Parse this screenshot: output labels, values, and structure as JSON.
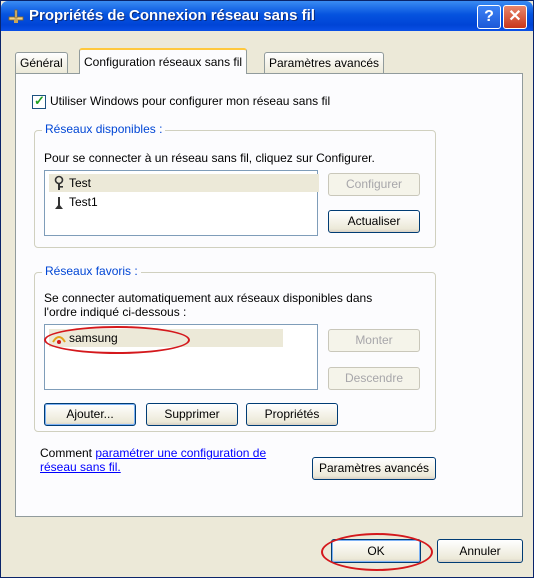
{
  "window": {
    "title": "Propriétés de Connexion réseau sans fil",
    "help_label": "?",
    "close_label": "✕"
  },
  "tabs": [
    {
      "label": "Général",
      "active": false
    },
    {
      "label": "Configuration réseaux sans fil",
      "active": true
    },
    {
      "label": "Paramètres avancés",
      "active": false
    }
  ],
  "use_windows_checkbox": {
    "label": "Utiliser Windows pour configurer mon réseau sans fil",
    "checked": true
  },
  "available_networks": {
    "title": "Réseaux disponibles :",
    "description": "Pour se connecter à un réseau sans fil, cliquez sur Configurer.",
    "items": [
      {
        "name": "Test",
        "icon": "key-icon",
        "selected": true
      },
      {
        "name": "Test1",
        "icon": "signal-antenna-icon",
        "selected": false
      }
    ],
    "configure_label": "Configurer",
    "refresh_label": "Actualiser"
  },
  "preferred_networks": {
    "title": "Réseaux favoris :",
    "description_line1": "Se connecter automatiquement aux réseaux disponibles dans",
    "description_line2": "l'ordre indiqué ci-dessous :",
    "items": [
      {
        "name": "samsung",
        "icon": "wireless-network-icon",
        "selected": true
      }
    ],
    "up_label": "Monter",
    "down_label": "Descendre",
    "add_label": "Ajouter...",
    "remove_label": "Supprimer",
    "properties_label": "Propriétés"
  },
  "footer_note": {
    "prefix": "Comment ",
    "link_line1": "paramétrer une configuration de",
    "link_line2": "réseau sans fil."
  },
  "advanced_button_label": "Paramètres avancés",
  "ok_label": "OK",
  "cancel_label": "Annuler",
  "colors": {
    "highlight_circle": "#d4181c",
    "titlebar": "#0553df",
    "link": "#0000ff"
  }
}
